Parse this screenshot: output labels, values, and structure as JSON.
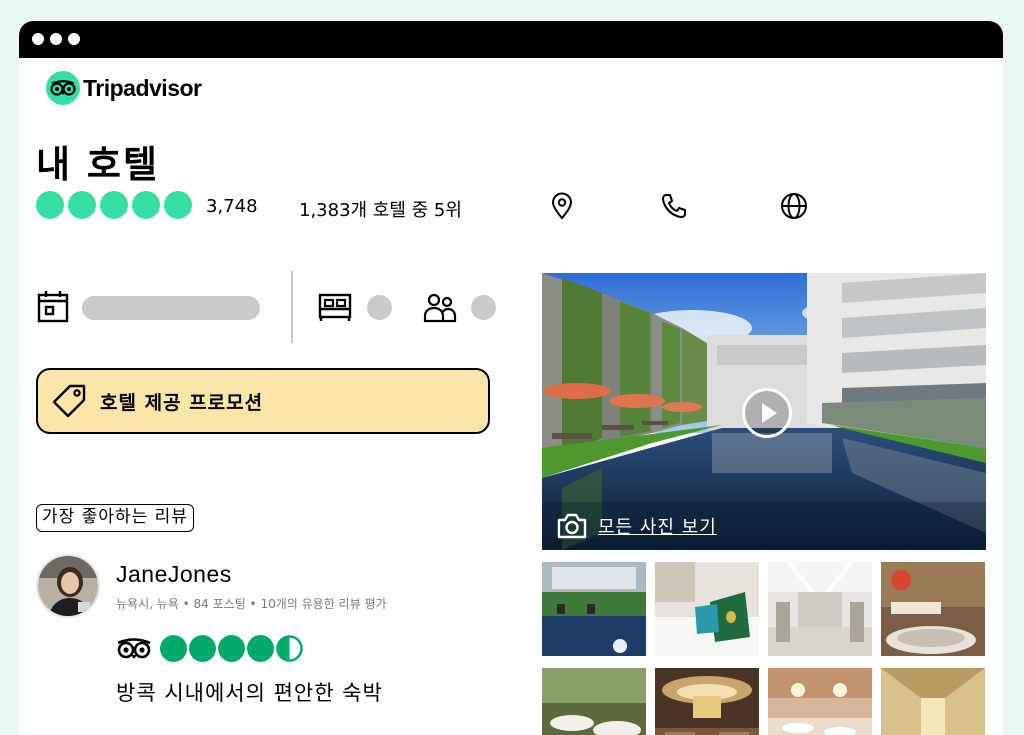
{
  "brand": {
    "name": "Tripadvisor",
    "accent": "#34e0a1",
    "review_green": "#00aa6c"
  },
  "hotel": {
    "title": "내 호텔",
    "rating_bubbles": 5,
    "review_count": "3,748",
    "ranking": "1,383개 호텔 중 5위"
  },
  "header_actions": [
    {
      "name": "location-pin-icon"
    },
    {
      "name": "phone-icon"
    },
    {
      "name": "globe-icon"
    }
  ],
  "search": {
    "date_icon": "calendar-icon",
    "rooms_icon": "bed-icon",
    "guests_icon": "guests-icon"
  },
  "promo": {
    "label": "호텔 제공 프로모션",
    "icon": "price-tag-icon",
    "bg": "#fbe5a9"
  },
  "reviews": {
    "section_label": "가장 좋아하는 리뷰",
    "featured": {
      "author": "JaneJones",
      "meta": "뉴욕시, 뉴욕 • 84 포스팅 • 10개의 유용한 리뷰 평가",
      "rating": 4.5,
      "title": "방콕 시내에서의 편안한 숙박"
    }
  },
  "gallery": {
    "view_all_label": "모든 사진 보기",
    "thumbnails": [
      "thumb-pool",
      "thumb-bedroom",
      "thumb-lobby",
      "thumb-spa",
      "thumb-restaurant",
      "thumb-lounge",
      "thumb-ballroom",
      "thumb-hallway"
    ]
  }
}
